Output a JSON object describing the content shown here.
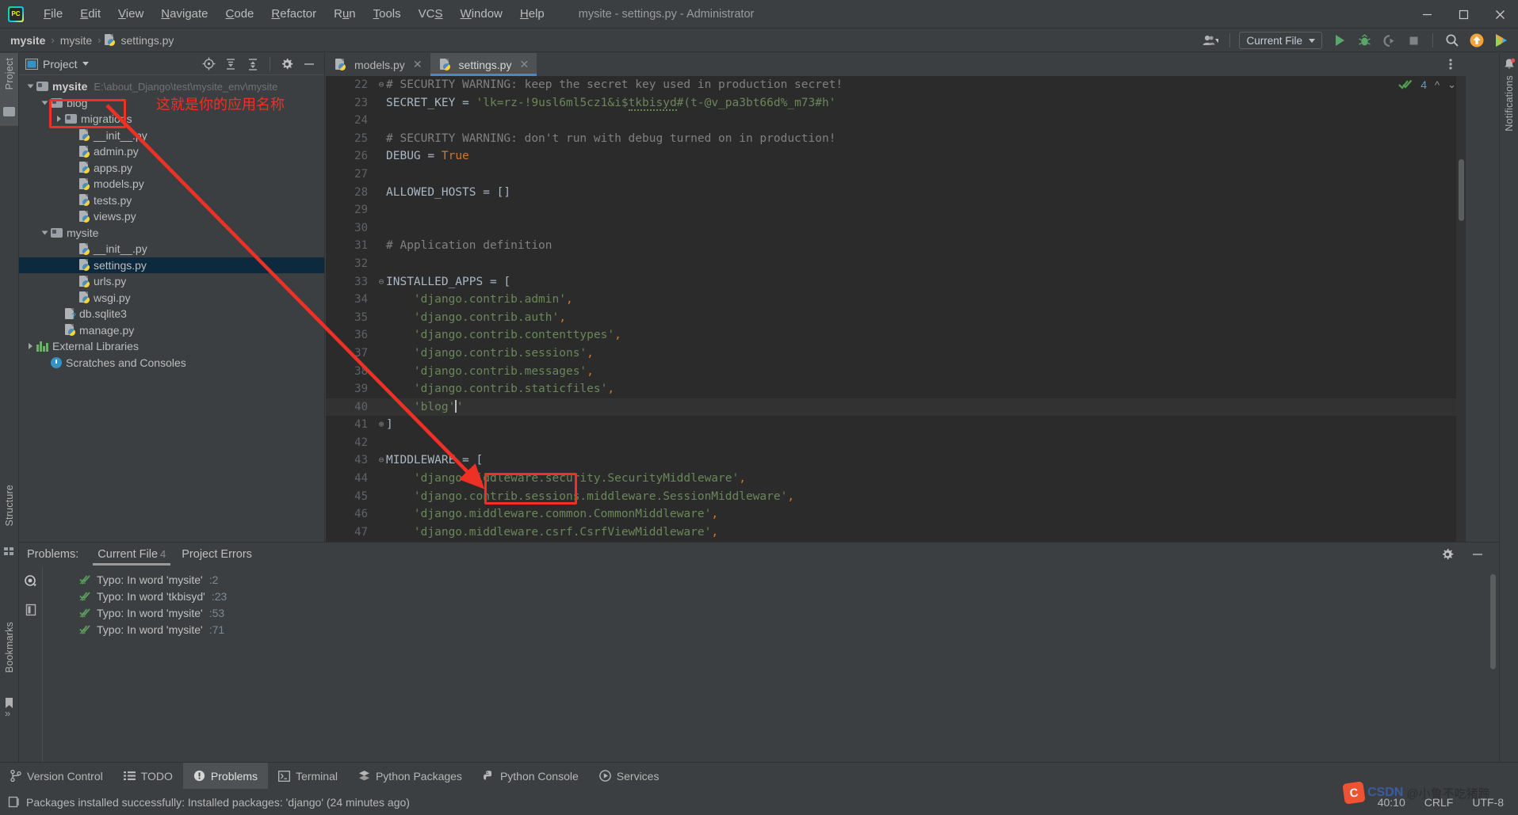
{
  "window": {
    "title": "mysite - settings.py - Administrator",
    "minimize": "—",
    "maximize": "❐",
    "close": "✕"
  },
  "menu": [
    {
      "label": "File"
    },
    {
      "label": "Edit"
    },
    {
      "label": "View"
    },
    {
      "label": "Navigate"
    },
    {
      "label": "Code"
    },
    {
      "label": "Refactor"
    },
    {
      "label": "Run"
    },
    {
      "label": "Tools"
    },
    {
      "label": "VCS"
    },
    {
      "label": "Window"
    },
    {
      "label": "Help"
    }
  ],
  "breadcrumb": {
    "items": [
      "mysite",
      "mysite",
      "settings.py"
    ],
    "separator": "›"
  },
  "toolbar": {
    "run_config": "Current File",
    "run_label": "Run",
    "debug_label": "Debug",
    "coverage_label": "Run with Coverage",
    "stop_label": "Stop",
    "search_label": "Search Everywhere",
    "update_label": "Update Project",
    "ide_label": "IDE and Project Settings"
  },
  "left_strip": {
    "project_label": "Project",
    "structure_label": "Structure",
    "bookmarks_label": "Bookmarks"
  },
  "right_strip": {
    "notifications_label": "Notifications"
  },
  "project_panel": {
    "title": "Project",
    "tree": [
      {
        "label": "mysite",
        "path": "E:\\about_Django\\test\\mysite_env\\mysite",
        "indent": 0,
        "type": "folder",
        "expanded": true,
        "bold": true
      },
      {
        "label": "blog",
        "path": "",
        "indent": 1,
        "type": "folder",
        "expanded": true,
        "bold": false
      },
      {
        "label": "migrations",
        "path": "",
        "indent": 2,
        "type": "folder",
        "expanded": false,
        "bold": false
      },
      {
        "label": "__init__.py",
        "path": "",
        "indent": 3,
        "type": "python",
        "bold": false
      },
      {
        "label": "admin.py",
        "path": "",
        "indent": 3,
        "type": "python",
        "bold": false
      },
      {
        "label": "apps.py",
        "path": "",
        "indent": 3,
        "type": "python",
        "bold": false
      },
      {
        "label": "models.py",
        "path": "",
        "indent": 3,
        "type": "python",
        "bold": false
      },
      {
        "label": "tests.py",
        "path": "",
        "indent": 3,
        "type": "python",
        "bold": false
      },
      {
        "label": "views.py",
        "path": "",
        "indent": 3,
        "type": "python",
        "bold": false
      },
      {
        "label": "mysite",
        "path": "",
        "indent": 1,
        "type": "folder",
        "expanded": true,
        "bold": false
      },
      {
        "label": "__init__.py",
        "path": "",
        "indent": 3,
        "type": "python",
        "bold": false
      },
      {
        "label": "settings.py",
        "path": "",
        "indent": 3,
        "type": "python",
        "bold": false,
        "selected": true
      },
      {
        "label": "urls.py",
        "path": "",
        "indent": 3,
        "type": "python",
        "bold": false
      },
      {
        "label": "wsgi.py",
        "path": "",
        "indent": 3,
        "type": "python",
        "bold": false
      },
      {
        "label": "db.sqlite3",
        "path": "",
        "indent": 2,
        "type": "unknown",
        "bold": false
      },
      {
        "label": "manage.py",
        "path": "",
        "indent": 2,
        "type": "python",
        "bold": false
      },
      {
        "label": "External Libraries",
        "path": "",
        "indent": 0,
        "type": "library",
        "expanded": false,
        "bold": false
      },
      {
        "label": "Scratches and Consoles",
        "path": "",
        "indent": 1,
        "type": "scratches",
        "bold": false
      }
    ]
  },
  "editor": {
    "tabs": [
      {
        "label": "models.py",
        "active": false
      },
      {
        "label": "settings.py",
        "active": true
      }
    ],
    "inspection_count": "4",
    "first_line": 22,
    "lines": [
      {
        "n": 22,
        "fold": "⊖",
        "tokens": [
          {
            "t": "# SECURITY WARNING: keep the secret key used in production secret!",
            "c": "cm"
          }
        ]
      },
      {
        "n": 23,
        "fold": "",
        "indent": 0,
        "tokens": [
          {
            "t": "SECRET_KEY ",
            "c": ""
          },
          {
            "t": "= ",
            "c": ""
          },
          {
            "t": "'lk=rz-!9usl6ml5cz1&i$",
            "c": "str"
          },
          {
            "t": "tkbisyd",
            "c": "str typo"
          },
          {
            "t": "#(t-@v_pa3bt66d%_m73#h'",
            "c": "str"
          }
        ]
      },
      {
        "n": 24,
        "fold": "",
        "tokens": []
      },
      {
        "n": 25,
        "fold": "",
        "tokens": [
          {
            "t": "# SECURITY WARNING: don't run with debug turned on in production!",
            "c": "cm"
          }
        ]
      },
      {
        "n": 26,
        "fold": "",
        "tokens": [
          {
            "t": "DEBUG ",
            "c": ""
          },
          {
            "t": "= ",
            "c": ""
          },
          {
            "t": "True",
            "c": "kw"
          }
        ]
      },
      {
        "n": 27,
        "fold": "",
        "tokens": []
      },
      {
        "n": 28,
        "fold": "",
        "tokens": [
          {
            "t": "ALLOWED_HOSTS = []",
            "c": ""
          }
        ]
      },
      {
        "n": 29,
        "fold": "",
        "tokens": []
      },
      {
        "n": 30,
        "fold": "",
        "tokens": []
      },
      {
        "n": 31,
        "fold": "",
        "tokens": [
          {
            "t": "# Application definition",
            "c": "cm"
          }
        ]
      },
      {
        "n": 32,
        "fold": "",
        "tokens": []
      },
      {
        "n": 33,
        "fold": "⊖",
        "tokens": [
          {
            "t": "INSTALLED_APPS = [",
            "c": ""
          }
        ]
      },
      {
        "n": 34,
        "fold": "",
        "tokens": [
          {
            "t": "    ",
            "c": ""
          },
          {
            "t": "'django.contrib.admin'",
            "c": "str"
          },
          {
            "t": ",",
            "c": "punc"
          }
        ]
      },
      {
        "n": 35,
        "fold": "",
        "tokens": [
          {
            "t": "    ",
            "c": ""
          },
          {
            "t": "'django.contrib.auth'",
            "c": "str"
          },
          {
            "t": ",",
            "c": "punc"
          }
        ]
      },
      {
        "n": 36,
        "fold": "",
        "tokens": [
          {
            "t": "    ",
            "c": ""
          },
          {
            "t": "'django.contrib.contenttypes'",
            "c": "str"
          },
          {
            "t": ",",
            "c": "punc"
          }
        ]
      },
      {
        "n": 37,
        "fold": "",
        "tokens": [
          {
            "t": "    ",
            "c": ""
          },
          {
            "t": "'django.contrib.sessions'",
            "c": "str"
          },
          {
            "t": ",",
            "c": "punc"
          }
        ]
      },
      {
        "n": 38,
        "fold": "",
        "tokens": [
          {
            "t": "    ",
            "c": ""
          },
          {
            "t": "'django.contrib.messages'",
            "c": "str"
          },
          {
            "t": ",",
            "c": "punc"
          }
        ]
      },
      {
        "n": 39,
        "fold": "",
        "tokens": [
          {
            "t": "    ",
            "c": ""
          },
          {
            "t": "'django.contrib.staticfiles'",
            "c": "str"
          },
          {
            "t": ",",
            "c": "punc"
          }
        ]
      },
      {
        "n": 40,
        "fold": "",
        "current": true,
        "tokens": [
          {
            "t": "    ",
            "c": ""
          },
          {
            "t": "'blog'",
            "c": "str"
          }
        ]
      },
      {
        "n": 41,
        "fold": "⊕",
        "tokens": [
          {
            "t": "]",
            "c": ""
          }
        ]
      },
      {
        "n": 42,
        "fold": "",
        "tokens": []
      },
      {
        "n": 43,
        "fold": "⊖",
        "tokens": [
          {
            "t": "MIDDLEWARE = [",
            "c": ""
          }
        ]
      },
      {
        "n": 44,
        "fold": "",
        "tokens": [
          {
            "t": "    ",
            "c": ""
          },
          {
            "t": "'django.middleware.security.SecurityMiddleware'",
            "c": "str"
          },
          {
            "t": ",",
            "c": "punc"
          }
        ]
      },
      {
        "n": 45,
        "fold": "",
        "tokens": [
          {
            "t": "    ",
            "c": ""
          },
          {
            "t": "'django.contrib.sessions.middleware.SessionMiddleware'",
            "c": "str"
          },
          {
            "t": ",",
            "c": "punc"
          }
        ]
      },
      {
        "n": 46,
        "fold": "",
        "tokens": [
          {
            "t": "    ",
            "c": ""
          },
          {
            "t": "'django.middleware.common.CommonMiddleware'",
            "c": "str"
          },
          {
            "t": ",",
            "c": "punc"
          }
        ]
      },
      {
        "n": 47,
        "fold": "",
        "tokens": [
          {
            "t": "    ",
            "c": ""
          },
          {
            "t": "'django.middleware.csrf.CsrfViewMiddleware'",
            "c": "str"
          },
          {
            "t": ",",
            "c": "punc"
          }
        ]
      }
    ]
  },
  "problems": {
    "label": "Problems:",
    "tabs": [
      {
        "label": "Current File",
        "count": "4",
        "active": true
      },
      {
        "label": "Project Errors",
        "count": "",
        "active": false
      }
    ],
    "rows": [
      {
        "text": "Typo: In word 'mysite'",
        "line": ":2"
      },
      {
        "text": "Typo: In word 'tkbisyd'",
        "line": ":23"
      },
      {
        "text": "Typo: In word 'mysite'",
        "line": ":53"
      },
      {
        "text": "Typo: In word 'mysite'",
        "line": ":71"
      }
    ]
  },
  "tool_windows": [
    {
      "label": "Version Control",
      "icon": "branch-icon",
      "active": false
    },
    {
      "label": "TODO",
      "icon": "list-icon",
      "active": false
    },
    {
      "label": "Problems",
      "icon": "warning-icon",
      "active": true
    },
    {
      "label": "Terminal",
      "icon": "terminal-icon",
      "active": false
    },
    {
      "label": "Python Packages",
      "icon": "packages-icon",
      "active": false
    },
    {
      "label": "Python Console",
      "icon": "python-icon",
      "active": false
    },
    {
      "label": "Services",
      "icon": "services-icon",
      "active": false
    }
  ],
  "statusbar": {
    "message": "Packages installed successfully: Installed packages: 'django' (24 minutes ago)",
    "position": "40:10",
    "line_separator": "CRLF",
    "encoding": "UTF-8"
  },
  "annotations": {
    "app_name_note": "这就是你的应用名称",
    "color": "#ee3124"
  },
  "watermark": {
    "brand": "CSDN",
    "author": "@小鲁不吃猪蹄"
  }
}
